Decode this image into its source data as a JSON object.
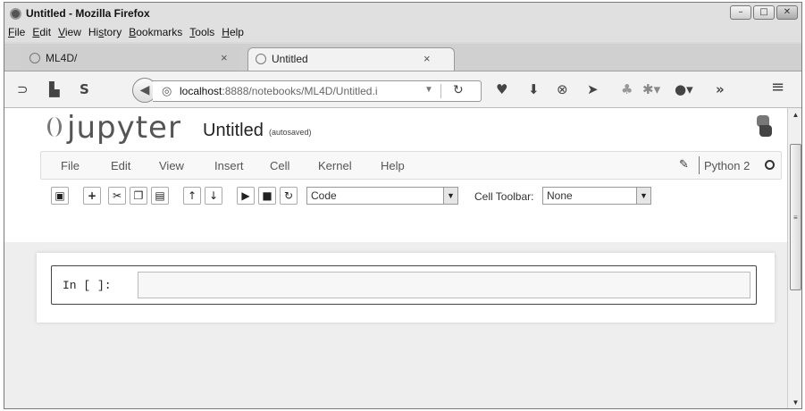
{
  "window": {
    "title": "Untitled - Mozilla Firefox",
    "controls": [
      "–",
      "□",
      "✕"
    ]
  },
  "menubar": [
    {
      "label": "File",
      "key": "F",
      "rest": "ile"
    },
    {
      "label": "Edit",
      "key": "E",
      "rest": "dit"
    },
    {
      "label": "View",
      "key": "V",
      "rest": "iew"
    },
    {
      "label": "History",
      "key": "s",
      "pre": "Hi",
      "rest": "tory"
    },
    {
      "label": "Bookmarks",
      "key": "B",
      "rest": "ookmarks"
    },
    {
      "label": "Tools",
      "key": "T",
      "rest": "ools"
    },
    {
      "label": "Help",
      "key": "H",
      "rest": "elp"
    }
  ],
  "tabs": [
    {
      "label": "ML4D/",
      "close": "×",
      "active": false
    },
    {
      "label": "Untitled",
      "close": "×",
      "active": true
    }
  ],
  "navbar": {
    "url_host": "localhost",
    "url_rest": ":8888/notebooks/ML4D/Untitled.i",
    "icons": [
      "rss-icon",
      "library-icon",
      "sync-icon",
      "pocket-icon",
      "download-icon",
      "block-icon",
      "send-icon",
      "leaf-icon",
      "extension-icon",
      "adblock-icon",
      "overflow-icon",
      "menu-icon"
    ]
  },
  "jupyter": {
    "logo": "jupyter",
    "notebook_name": "Untitled",
    "autosave_status": "(autosaved)",
    "menu": [
      "File",
      "Edit",
      "View",
      "Insert",
      "Cell",
      "Kernel",
      "Help"
    ],
    "kernel_name": "Python 2",
    "cell_type": "Code",
    "cell_toolbar_label": "Cell Toolbar:",
    "cell_toolbar_value": "None",
    "cell_prompt": "In [ ]:"
  }
}
